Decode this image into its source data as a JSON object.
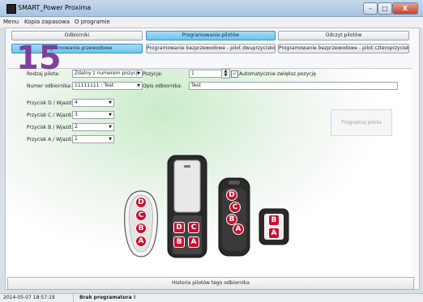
{
  "window": {
    "title": "SMART_Power Proxima",
    "min": "–",
    "max": "□",
    "close": "X"
  },
  "menu": [
    "Menu",
    "Kopia zapasowa",
    "O programie"
  ],
  "tabs_top": [
    "Odbiorniki",
    "Programowanie pilotów",
    "Odczyt pilotów"
  ],
  "tabs_sub": [
    "Programowanie przewodowe",
    "Programowanie bezprzewodowe - pilot dwuprzyciskowy",
    "Programowanie bezprzewodowe - pilot czteroprzyciskowy"
  ],
  "overlay_number": "15",
  "form": {
    "rodzaj_label": "Rodzaj pilota:",
    "rodzaj_value": "Zdalny z numerem pozycji",
    "pozycja_label": "Pozycja:",
    "pozycja_value": "1",
    "auto_label": "Automatycznie zwiększ pozycję",
    "numer_label": "Numer odbiornika:",
    "numer_value": "11111111 : Test",
    "opis_label": "Opis odbiornika:",
    "opis_value": "Test",
    "przyciski": [
      {
        "label": "Przycisk D / Wjazd:",
        "value": "4"
      },
      {
        "label": "Przycisk C / Wjazd:",
        "value": "3"
      },
      {
        "label": "Przycisk B / Wjazd:",
        "value": "2"
      },
      {
        "label": "Przycisk A / Wjazd:",
        "value": "1"
      }
    ]
  },
  "program_button": "Programuj pilota",
  "history_button": "Historia pilotów tego odbiornika",
  "status": {
    "datetime": "2014-05-07 18:57:19",
    "message": "Brak programatora !"
  },
  "remote_letters": {
    "d": "D",
    "c": "C",
    "b": "B",
    "a": "A"
  },
  "colors": {
    "accent": "#6cc4ee",
    "button_red": "#c8102e",
    "badge": "#7d3a98"
  }
}
